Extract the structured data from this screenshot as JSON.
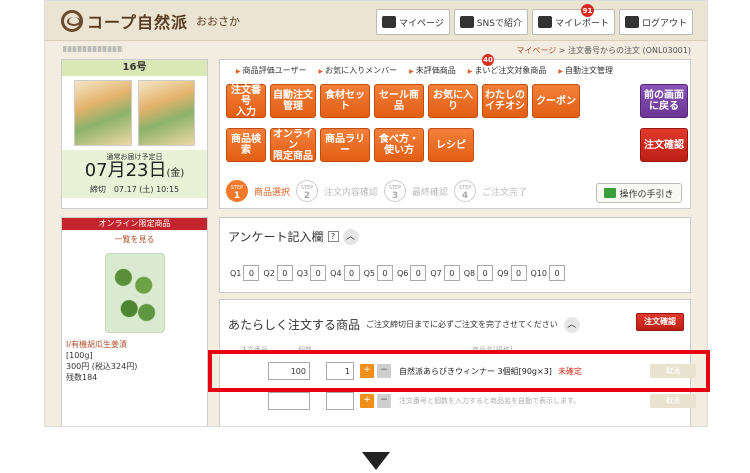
{
  "header": {
    "brand": "コープ自然派",
    "area": "おおさか",
    "buttons": [
      {
        "label": "マイページ",
        "icon": "home-icon"
      },
      {
        "label": "SNSで紹介",
        "icon": "mail-icon"
      },
      {
        "label": "マイレポート",
        "icon": "report-icon",
        "badge": "91"
      },
      {
        "label": "ログアウト",
        "icon": "lock-icon"
      }
    ]
  },
  "breadcrumb": {
    "link": "マイページ",
    "sep": ">",
    "current": "注文番号からの注文 (ONL03001)"
  },
  "catalog": {
    "issue": "16号",
    "delivery_label": "通常お届け予定日",
    "delivery_date": "07月23日",
    "delivery_dow": "(金)",
    "deadline": "締切　07.17 (土) 10:15"
  },
  "promo": {
    "header": "オンライン限定商品",
    "link": "一覧を見る",
    "product_name": "I/有機胡瓜生姜漬",
    "amount": "[100g]",
    "price": "300円 (税込324円)",
    "stock": "残数184"
  },
  "quick_links": [
    "商品評価ユーザー",
    "お気に入りメンバー",
    "未評価商品",
    "まいど注文対象商品",
    "自動注文管理"
  ],
  "unrated_badge": "40",
  "menu_buttons": {
    "order_number": "注文番号\n入力",
    "auto_order": "自動注文\n管理",
    "ingredients": "食材セット",
    "sale": "セール商品",
    "favorites": "お気に入り",
    "my_pick": "わたしの\nイチオシ",
    "coupon": "クーポン",
    "back": "前の画面\nに戻る",
    "search": "商品検索",
    "online_only": "オンライン\n限定商品",
    "rally": "商品ラリー",
    "howto": "食べ方・\n使い方",
    "recipe": "レシピ",
    "confirm": "注文確認"
  },
  "steps": [
    {
      "no": "1",
      "label": "商品選択",
      "active": true
    },
    {
      "no": "2",
      "label": "注文内容確認",
      "active": false
    },
    {
      "no": "3",
      "label": "最終確認",
      "active": false
    },
    {
      "no": "4",
      "label": "ご注文完了",
      "active": false
    }
  ],
  "guide_button": "操作の手引き",
  "survey": {
    "title": "アンケート記入欄",
    "help": "?",
    "questions": [
      {
        "label": "Q1",
        "value": "0"
      },
      {
        "label": "Q2",
        "value": "0"
      },
      {
        "label": "Q3",
        "value": "0"
      },
      {
        "label": "Q4",
        "value": "0"
      },
      {
        "label": "Q5",
        "value": "0"
      },
      {
        "label": "Q6",
        "value": "0"
      },
      {
        "label": "Q7",
        "value": "0"
      },
      {
        "label": "Q8",
        "value": "0"
      },
      {
        "label": "Q9",
        "value": "0"
      },
      {
        "label": "Q10",
        "value": "0"
      }
    ]
  },
  "new_order": {
    "title": "あたらしく注文する商品",
    "note": "ご注文締切日までに必ずご注文を完了させてください",
    "confirm": "注文確認",
    "columns": [
      "注文番号",
      "個数",
      "商品名[規格]"
    ],
    "row1": {
      "order_no": "100",
      "qty": "1",
      "name": "自然派あらびきウィンナー 3個組[90g×3]",
      "status": "未確定",
      "cancel": "取消"
    },
    "row2": {
      "hint": "注文番号と個数を入力すると商品名を自動で表示します。",
      "cancel": "取消"
    }
  }
}
